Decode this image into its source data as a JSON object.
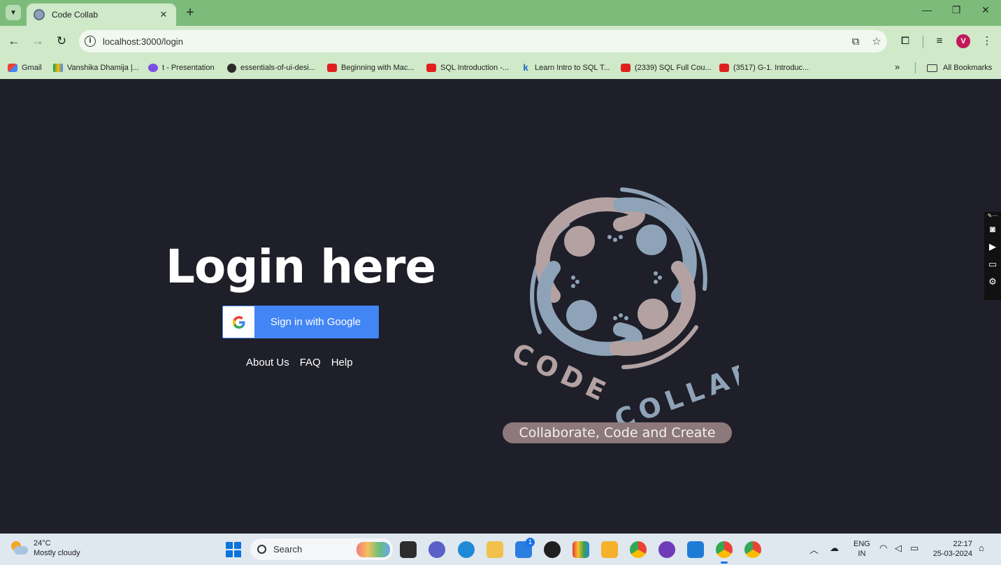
{
  "browser": {
    "tab_title": "Code Collab",
    "url": "localhost:3000/login",
    "profile_initial": "V",
    "bookmarks": [
      {
        "label": "Gmail",
        "icon": "gmail-icon"
      },
      {
        "label": "Vanshika Dhamija |...",
        "icon": "drive-icon"
      },
      {
        "label": "t - Presentation",
        "icon": "presentation-icon"
      },
      {
        "label": "essentials-of-ui-desi...",
        "icon": "globe-icon"
      },
      {
        "label": "Beginning with Mac...",
        "icon": "youtube-icon"
      },
      {
        "label": "SQL Introduction -...",
        "icon": "youtube-icon"
      },
      {
        "label": "Learn Intro to SQL T...",
        "icon": "k-icon"
      },
      {
        "label": "(2339) SQL Full Cou...",
        "icon": "youtube-icon"
      },
      {
        "label": "(3517) G-1. Introduc...",
        "icon": "youtube-icon"
      }
    ],
    "all_bookmarks_label": "All Bookmarks"
  },
  "login": {
    "heading": "Login here",
    "google_button_label": "Sign in with Google",
    "google_glyph": "G",
    "links": [
      "About Us",
      "FAQ",
      "Help"
    ]
  },
  "logo": {
    "text_left": "CODE",
    "text_right": "COLLAB",
    "tagline": "Collaborate, Code and Create",
    "colors": {
      "blue": "#8fa3b8",
      "mauve": "#b4a2a2",
      "tagline_bg": "#8d797b"
    }
  },
  "taskbar": {
    "weather_temp": "24°C",
    "weather_desc": "Mostly cloudy",
    "search_placeholder": "Search",
    "lang_line1": "ENG",
    "lang_line2": "IN",
    "time": "22:17",
    "date": "25-03-2024",
    "notification_badge": "1"
  },
  "colors": {
    "page_bg": "#1e1f29",
    "chrome_green": "#7dbb7b",
    "chrome_light": "#cfe9c9",
    "google_blue": "#4285f4"
  }
}
